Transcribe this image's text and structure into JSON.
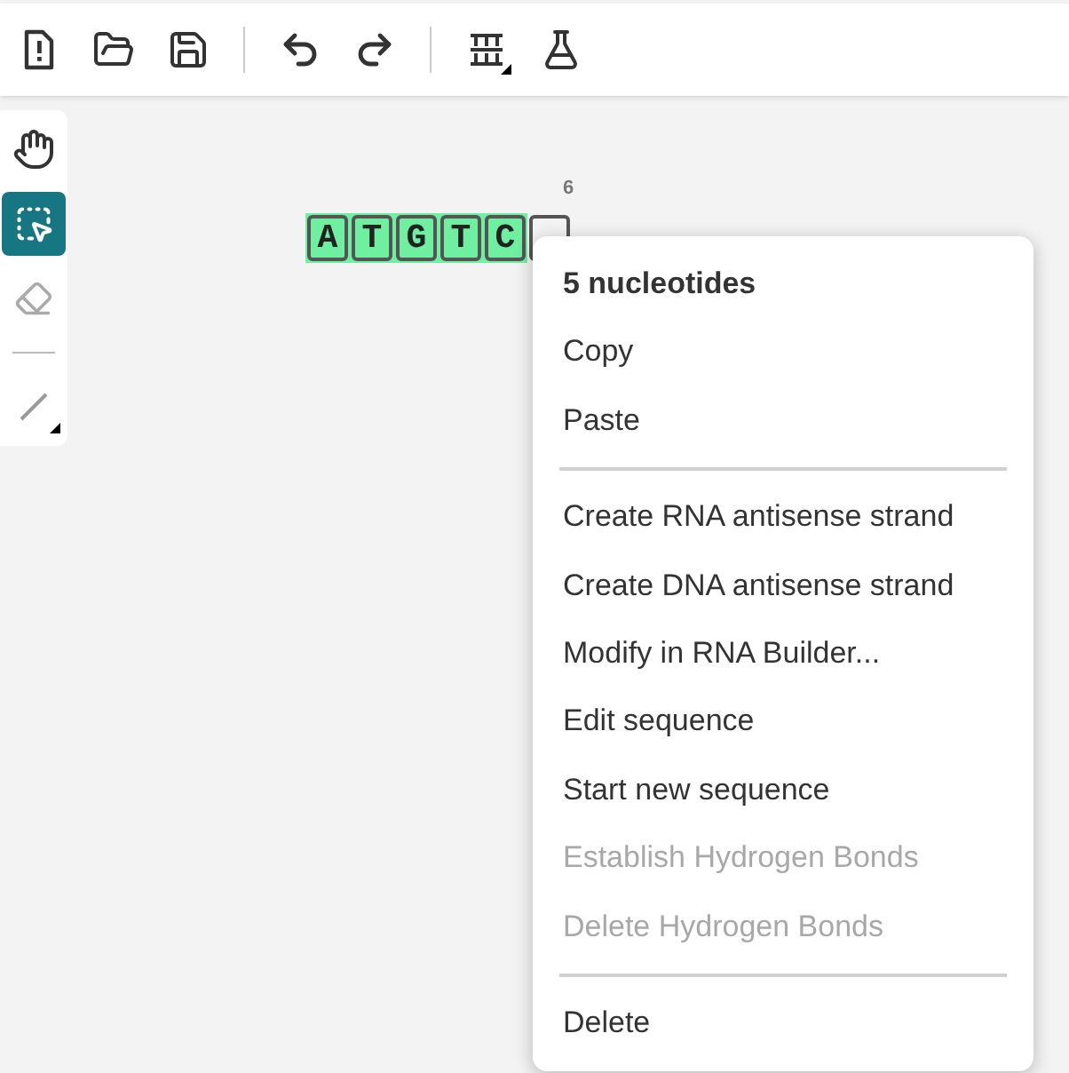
{
  "left_tools": [
    {
      "kind": "hand",
      "selected": false
    },
    {
      "kind": "select",
      "selected": true
    },
    {
      "kind": "eraser",
      "selected": false
    },
    {
      "kind": "bond",
      "selected": false
    }
  ],
  "sequence": {
    "position_label": "6",
    "nucleotides": [
      {
        "letter": "A",
        "selected": true
      },
      {
        "letter": "T",
        "selected": true
      },
      {
        "letter": "G",
        "selected": true
      },
      {
        "letter": "T",
        "selected": true
      },
      {
        "letter": "C",
        "selected": true
      },
      {
        "selected": false
      }
    ]
  },
  "context_menu": {
    "title": "5 nucleotides",
    "items": [
      {
        "kind": "item",
        "label": "Copy",
        "disabled": false
      },
      {
        "kind": "item",
        "label": "Paste",
        "disabled": false
      },
      {
        "kind": "divider"
      },
      {
        "kind": "item",
        "label": "Create RNA antisense strand",
        "disabled": false
      },
      {
        "kind": "item",
        "label": "Create DNA antisense strand",
        "disabled": false
      },
      {
        "kind": "item",
        "label": "Modify in RNA Builder...",
        "disabled": false
      },
      {
        "kind": "item",
        "label": "Edit sequence",
        "disabled": false
      },
      {
        "kind": "item",
        "label": "Start new sequence",
        "disabled": false
      },
      {
        "kind": "item",
        "label": "Establish Hydrogen Bonds",
        "disabled": true
      },
      {
        "kind": "item",
        "label": "Delete Hydrogen Bonds",
        "disabled": true
      },
      {
        "kind": "divider"
      },
      {
        "kind": "item",
        "label": "Delete",
        "disabled": false
      }
    ]
  }
}
